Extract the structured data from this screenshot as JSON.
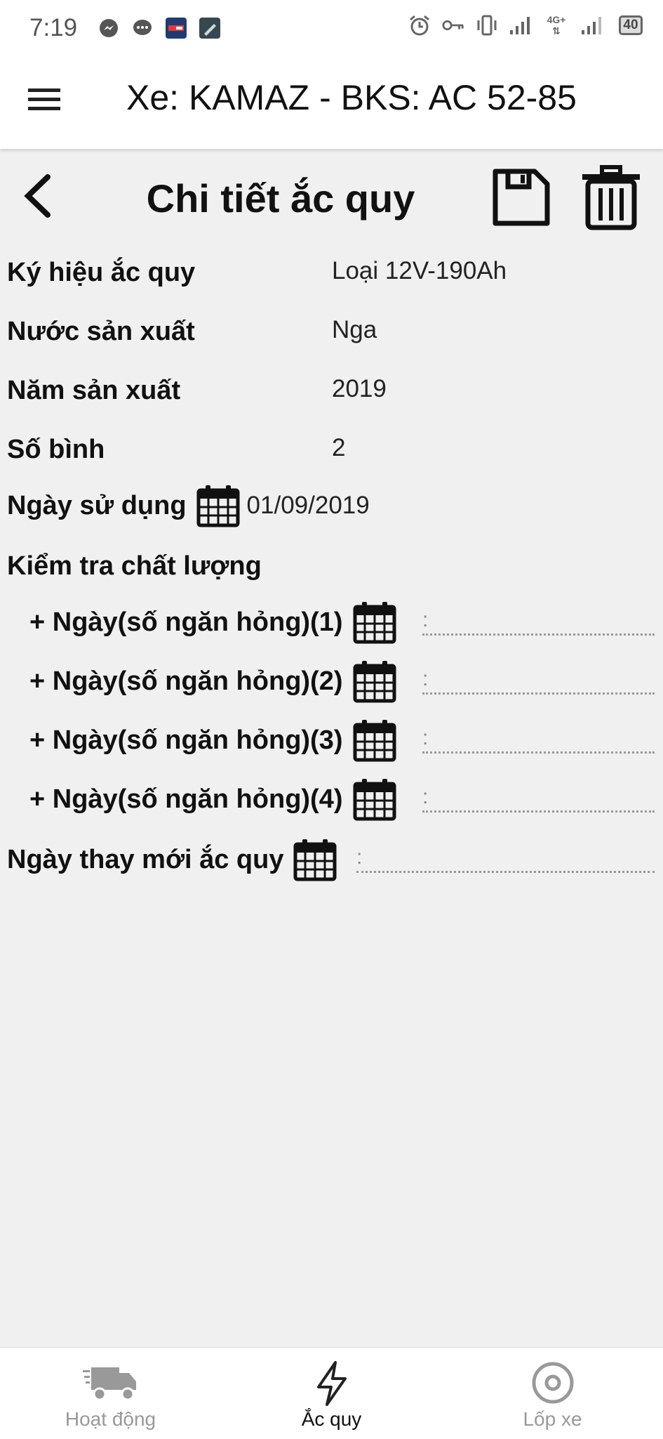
{
  "statusbar": {
    "time": "7:19",
    "network": "4G+",
    "battery": "40"
  },
  "appbar": {
    "title": "Xe: KAMAZ - BKS: AC 52-85"
  },
  "page": {
    "title": "Chi tiết ắc quy"
  },
  "fields": [
    {
      "label": "Ký hiệu ắc quy",
      "value": "Loại 12V-190Ah"
    },
    {
      "label": "Nước sản xuất",
      "value": "Nga"
    },
    {
      "label": "Năm sản xuất",
      "value": "2019"
    },
    {
      "label": "Số bình",
      "value": "2"
    }
  ],
  "usage_date": {
    "label": "Ngày sử dụng",
    "value": "01/09/2019"
  },
  "quality_check": {
    "label": "Kiểm tra chất lượng",
    "items": [
      {
        "label": "+ Ngày(số ngăn hỏng)(1)"
      },
      {
        "label": "+ Ngày(số ngăn hỏng)(2)"
      },
      {
        "label": "+ Ngày(số ngăn hỏng)(3)"
      },
      {
        "label": "+ Ngày(số ngăn hỏng)(4)"
      }
    ],
    "separator": ":"
  },
  "replace_date": {
    "label": "Ngày thay mới ắc quy"
  },
  "bottom_nav": [
    {
      "label": "Hoạt động",
      "icon": "truck-icon"
    },
    {
      "label": "Ắc quy",
      "icon": "lightning-icon",
      "active": true
    },
    {
      "label": "Lốp xe",
      "icon": "tire-icon"
    }
  ]
}
